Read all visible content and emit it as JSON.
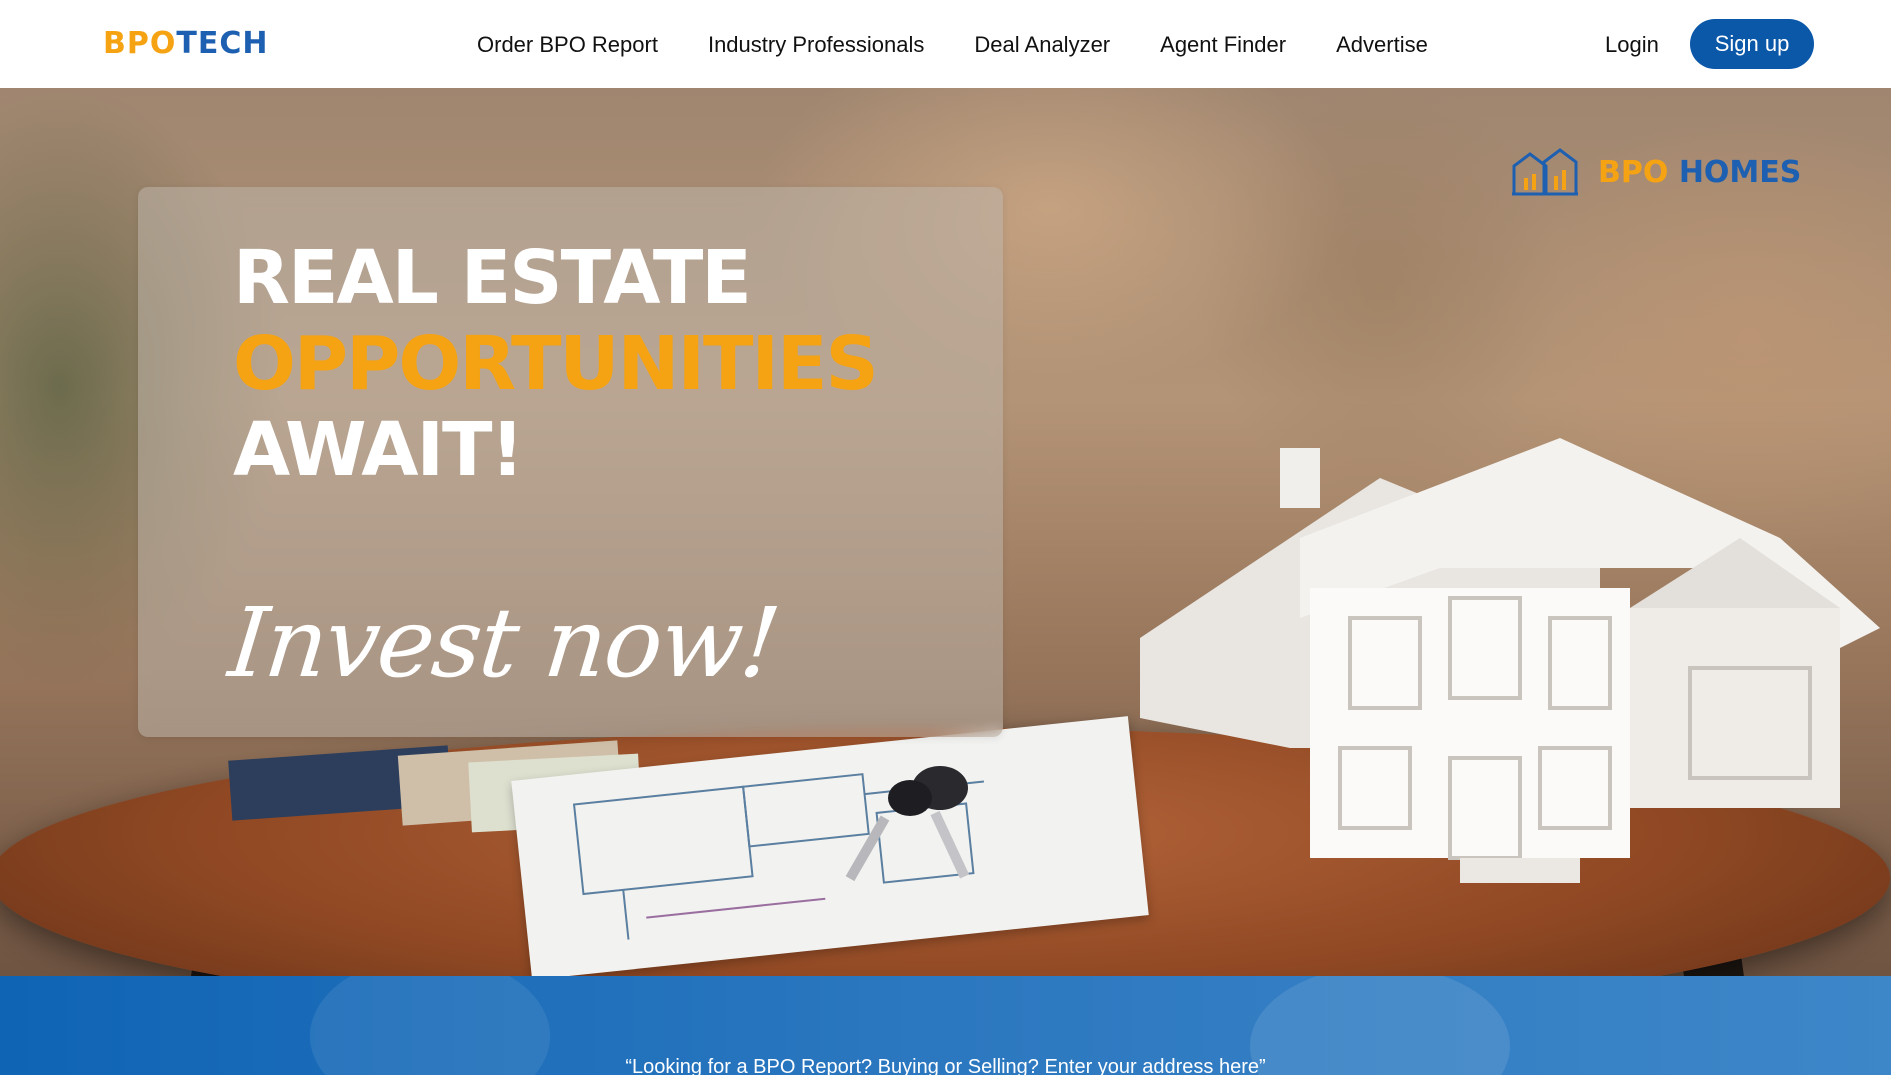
{
  "header": {
    "logo_part1": "BPO",
    "logo_part2": "TECH",
    "nav": [
      {
        "label": "Order BPO Report"
      },
      {
        "label": "Industry Professionals"
      },
      {
        "label": "Deal Analyzer"
      },
      {
        "label": "Agent Finder"
      },
      {
        "label": "Advertise"
      }
    ],
    "login_label": "Login",
    "signup_label": "Sign up"
  },
  "hero": {
    "headline_line1": "REAL ESTATE",
    "headline_line2": "OPPORTUNITIES",
    "headline_line3": "AWAIT!",
    "tagline": "Invest now!",
    "brand_part1": "BPO",
    "brand_part2": "HOMES",
    "brand_icon": "house-outline-icon"
  },
  "search": {
    "prompt": "“Looking for a BPO Report? Buying or Selling? Enter your address here”"
  },
  "colors": {
    "accent_orange": "#f6a313",
    "brand_blue": "#1d5fb0",
    "button_blue": "#0b57a8"
  }
}
